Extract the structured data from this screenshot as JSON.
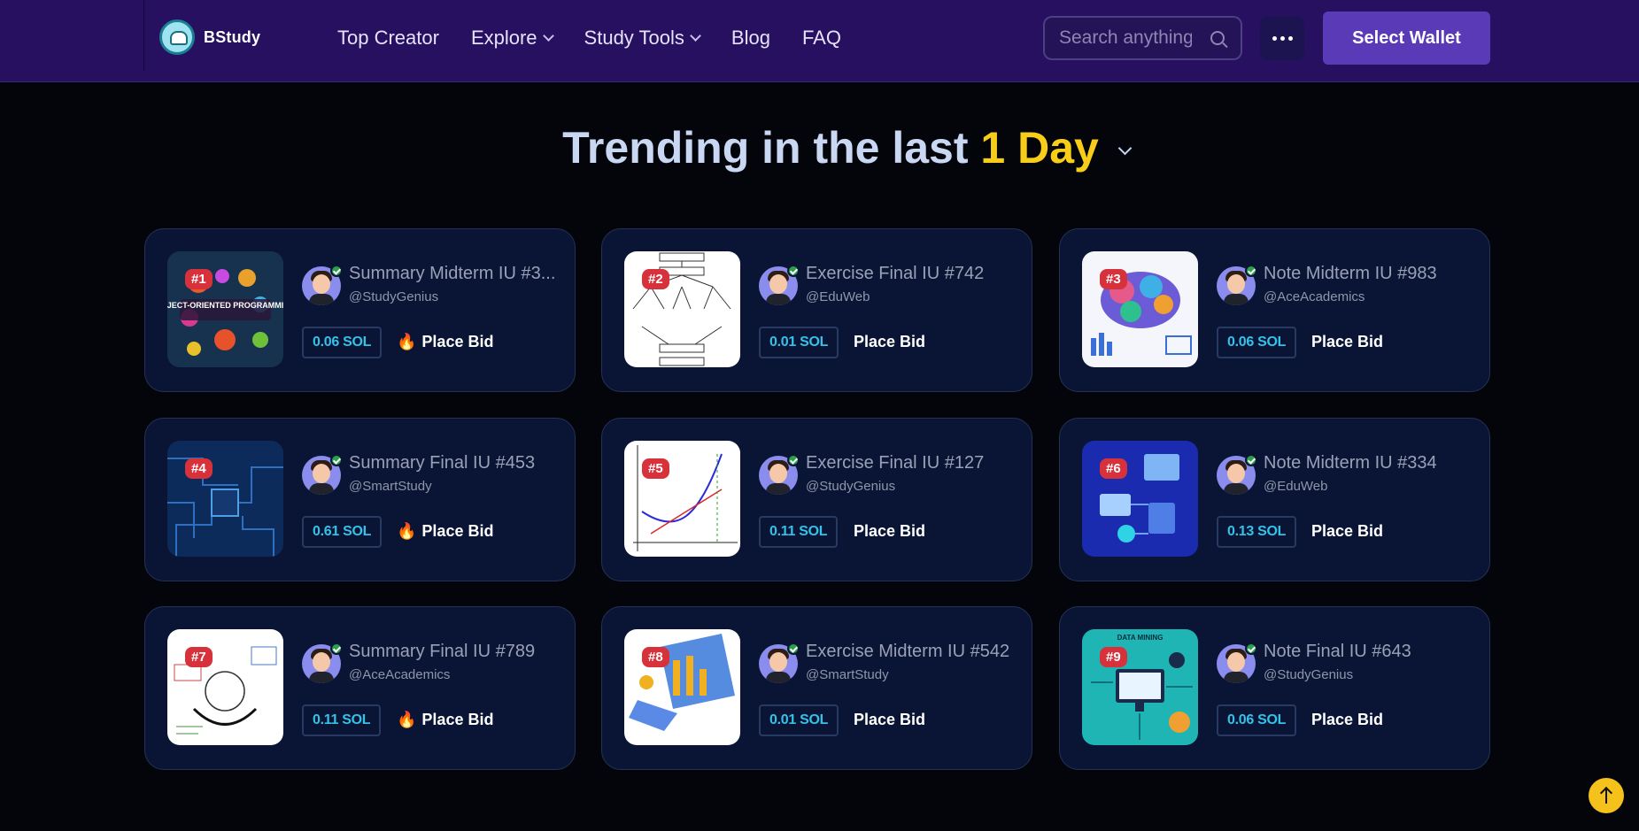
{
  "nav": {
    "logo_text": "BStudy",
    "menu": [
      {
        "label": "Top Creator",
        "has_dropdown": false
      },
      {
        "label": "Explore",
        "has_dropdown": true
      },
      {
        "label": "Study Tools",
        "has_dropdown": true
      },
      {
        "label": "Blog",
        "has_dropdown": false
      },
      {
        "label": "FAQ",
        "has_dropdown": false
      }
    ],
    "search_placeholder": "Search anything",
    "wallet_label": "Select Wallet"
  },
  "heading": {
    "prefix": "Trending in the last",
    "highlight": "1 Day"
  },
  "cards": [
    {
      "rank": "#1",
      "title": "Summary Midterm IU #3...",
      "handle": "@StudyGenius",
      "price": "0.06 SOL",
      "bid": "Place Bid",
      "hot": true
    },
    {
      "rank": "#2",
      "title": "Exercise Final IU #742",
      "handle": "@EduWeb",
      "price": "0.01 SOL",
      "bid": "Place Bid",
      "hot": false
    },
    {
      "rank": "#3",
      "title": "Note Midterm IU #983",
      "handle": "@AceAcademics",
      "price": "0.06 SOL",
      "bid": "Place Bid",
      "hot": false
    },
    {
      "rank": "#4",
      "title": "Summary Final IU #453",
      "handle": "@SmartStudy",
      "price": "0.61 SOL",
      "bid": "Place Bid",
      "hot": true
    },
    {
      "rank": "#5",
      "title": "Exercise Final IU #127",
      "handle": "@StudyGenius",
      "price": "0.11 SOL",
      "bid": "Place Bid",
      "hot": false
    },
    {
      "rank": "#6",
      "title": "Note Midterm IU #334",
      "handle": "@EduWeb",
      "price": "0.13 SOL",
      "bid": "Place Bid",
      "hot": false
    },
    {
      "rank": "#7",
      "title": "Summary Final IU #789",
      "handle": "@AceAcademics",
      "price": "0.11 SOL",
      "bid": "Place Bid",
      "hot": true
    },
    {
      "rank": "#8",
      "title": "Exercise Midterm IU #542",
      "handle": "@SmartStudy",
      "price": "0.01 SOL",
      "bid": "Place Bid",
      "hot": false
    },
    {
      "rank": "#9",
      "title": "Note Final IU #643",
      "handle": "@StudyGenius",
      "price": "0.06 SOL",
      "bid": "Place Bid",
      "hot": false
    }
  ],
  "thumbnail_texts": {
    "oop": "OBJECT-ORIENTED PROGRAMMING",
    "data_mining": "DATA MINING"
  },
  "colors": {
    "nav_bg": "#26105f",
    "page_bg": "#04050b",
    "card_bg": "#0a1535",
    "accent_yellow": "#f7cd1a",
    "price_cyan": "#35c2e8",
    "rank_red": "#d7313c",
    "wallet_purple": "#5b3ab8"
  }
}
